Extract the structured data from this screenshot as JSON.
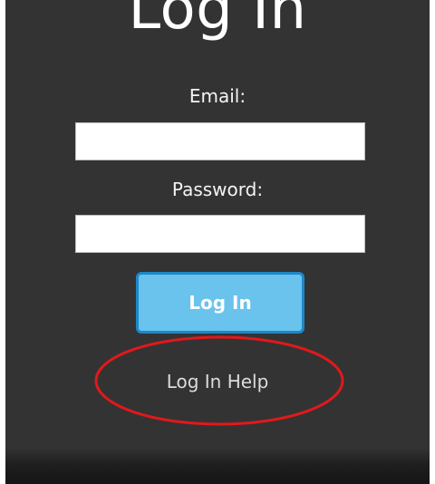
{
  "login_form": {
    "title": "Log In",
    "email_label": "Email:",
    "email_value": "",
    "password_label": "Password:",
    "password_value": "",
    "submit_label": "Log In",
    "help_link_label": "Log In Help"
  },
  "annotation": {
    "type": "ellipse",
    "target": "help-link",
    "color": "#e0191b"
  },
  "colors": {
    "background": "#333333",
    "button_fill": "#69c3ec",
    "button_border": "#1e87c9",
    "text": "#ffffff"
  }
}
